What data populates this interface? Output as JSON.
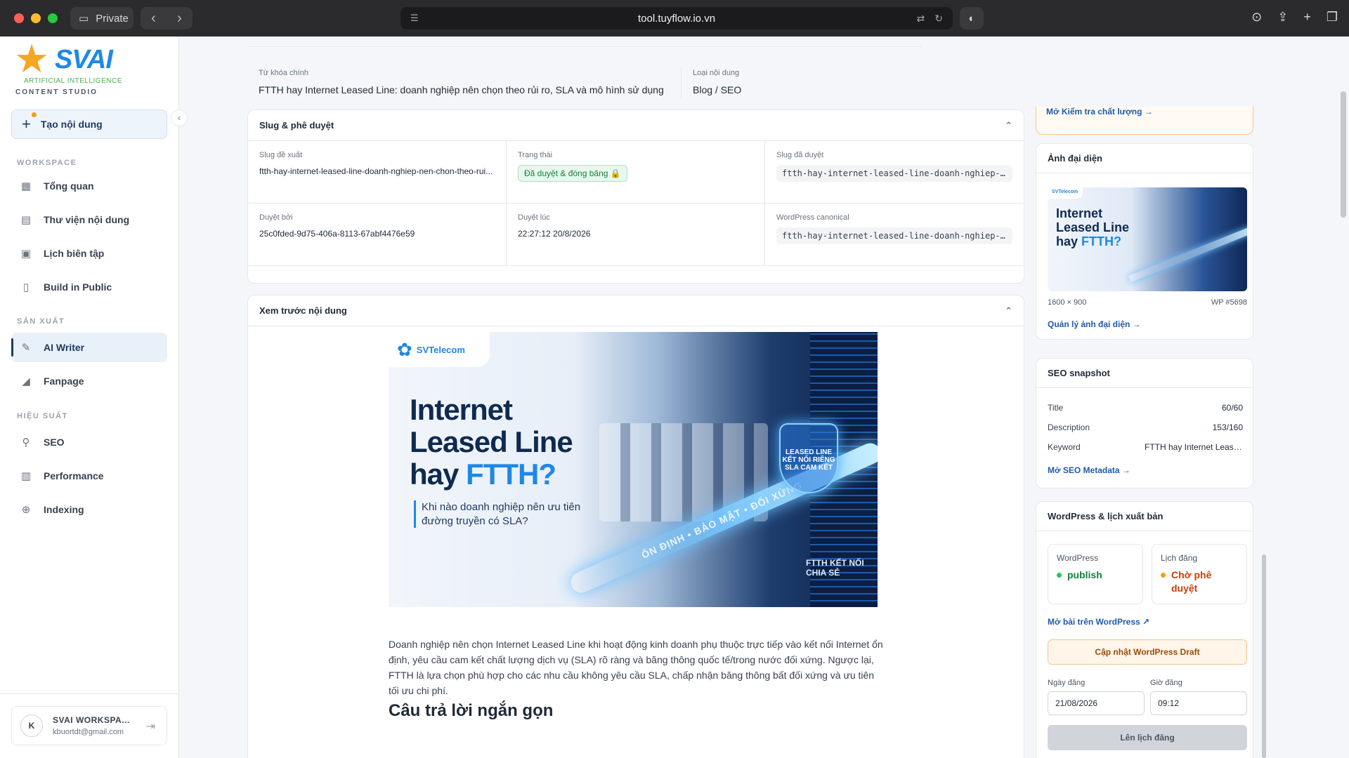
{
  "browser": {
    "private_label": "Private",
    "url": "tool.tuyflow.io.vn"
  },
  "sidebar": {
    "logo_text": "SVAI",
    "logo_sub": "ARTIFICIAL INTELLIGENCE",
    "logo_studio": "CONTENT STUDIO",
    "create_label": "Tạo nội dung",
    "sections": {
      "workspace": "WORKSPACE",
      "production": "SẢN XUẤT",
      "performance": "HIỆU SUẤT"
    },
    "items": [
      {
        "label": "Tổng quan",
        "icon": "grid-icon"
      },
      {
        "label": "Thư viện nội dung",
        "icon": "document-icon"
      },
      {
        "label": "Lịch biên tập",
        "icon": "calendar-icon"
      },
      {
        "label": "Build in Public",
        "icon": "file-icon"
      },
      {
        "label": "AI Writer",
        "icon": "pen-icon",
        "active": true
      },
      {
        "label": "Fanpage",
        "icon": "megaphone-icon"
      },
      {
        "label": "SEO",
        "icon": "search-icon"
      },
      {
        "label": "Performance",
        "icon": "bar-chart-icon"
      },
      {
        "label": "Indexing",
        "icon": "search-zoom-icon"
      }
    ],
    "user": {
      "initial": "K",
      "name": "SVAI WORKSPA...",
      "email": "kbuortdt@gmail.com"
    }
  },
  "main": {
    "keyword": {
      "label": "Từ khóa chính",
      "value": "FTTH hay Internet Leased Line: doanh nghiệp nên chọn theo rủi ro, SLA và mô hình sử dụng"
    },
    "content_type": {
      "label": "Loại nội dung",
      "value": "Blog / SEO"
    },
    "slug_card": {
      "title": "Slug & phê duyệt",
      "cells": [
        {
          "label": "Slug đề xuất",
          "value": "ftth-hay-internet-leased-line-doanh-nghiep-nen-chon-theo-rui..."
        },
        {
          "label": "Trạng thái",
          "value": "Đã duyệt & đóng băng 🔒"
        },
        {
          "label": "Slug đã duyệt",
          "value": "ftth-hay-internet-leased-line-doanh-nghiep-nen-chon-theo-rui-ro"
        },
        {
          "label": "Duyệt bởi",
          "value": "25c0fded-9d75-406a-8113-67abf4476e59"
        },
        {
          "label": "Duyệt lúc",
          "value": "22:27:12 20/8/2026"
        },
        {
          "label": "WordPress canonical",
          "value": "ftth-hay-internet-leased-line-doanh-nghiep-nen-chon-theo-rui-ro"
        }
      ]
    },
    "preview_card": {
      "title": "Xem trước nội dung",
      "hero": {
        "logo": "SVTelecom",
        "title_line1": "Internet",
        "title_line2": "Leased Line",
        "title_line3": "hay",
        "title_accent": "FTTH?",
        "subtitle": "Khi nào doanh nghiệp nên ưu tiên đường truyền có SLA?",
        "shield_text": "LEASED LINE KẾT NỐI RIÊNG SLA CAM KẾT",
        "beam_text": "ỔN ĐỊNH • BẢO MẬT • ĐỐI XỨNG",
        "ftth_text": "FTTH KẾT NỐI CHIA SẺ"
      },
      "paragraph": "Doanh nghiệp nên chọn Internet Leased Line khi hoạt động kinh doanh phụ thuộc trực tiếp vào kết nối Internet ổn định, yêu cầu cam kết chất lượng dịch vụ (SLA) rõ ràng và băng thông quốc tế/trong nước đối xứng. Ngược lại, FTTH là lựa chọn phù hợp cho các nhu cầu không yêu cầu SLA, chấp nhận băng thông bất đối xứng và ưu tiên tối ưu chi phí.",
      "heading": "Câu trả lời ngắn gọn"
    }
  },
  "right": {
    "quality_link": "Mở Kiểm tra chất lượng →",
    "featured": {
      "title": "Ảnh đại diện",
      "thumb_title": "Internet Leased Line hay FTTH?",
      "dimensions": "1600 × 900",
      "wp_id": "WP #5698",
      "manage_link": "Quản lý ảnh đại diện →"
    },
    "seo": {
      "title": "SEO snapshot",
      "rows": [
        {
          "key": "Title",
          "value": "60/60"
        },
        {
          "key": "Description",
          "value": "153/160"
        },
        {
          "key": "Keyword",
          "value": "FTTH hay Internet Leased Line"
        }
      ],
      "link": "Mở SEO Metadata →"
    },
    "wordpress": {
      "title": "WordPress & lịch xuất bản",
      "wp_label": "WordPress",
      "wp_status": "publish",
      "schedule_label": "Lịch đăng",
      "schedule_status": "Chờ phê duyệt",
      "open_link": "Mở bài trên WordPress ↗",
      "update_button": "Cập nhật WordPress Draft",
      "date_label": "Ngày đăng",
      "date_value": "21/08/2026",
      "time_label": "Giờ đăng",
      "time_value": "09:12",
      "schedule_button": "Lên lịch đăng"
    }
  },
  "colors": {
    "accent": "#1e5aa8",
    "success": "#22c55e",
    "warning": "#f59e0b"
  }
}
